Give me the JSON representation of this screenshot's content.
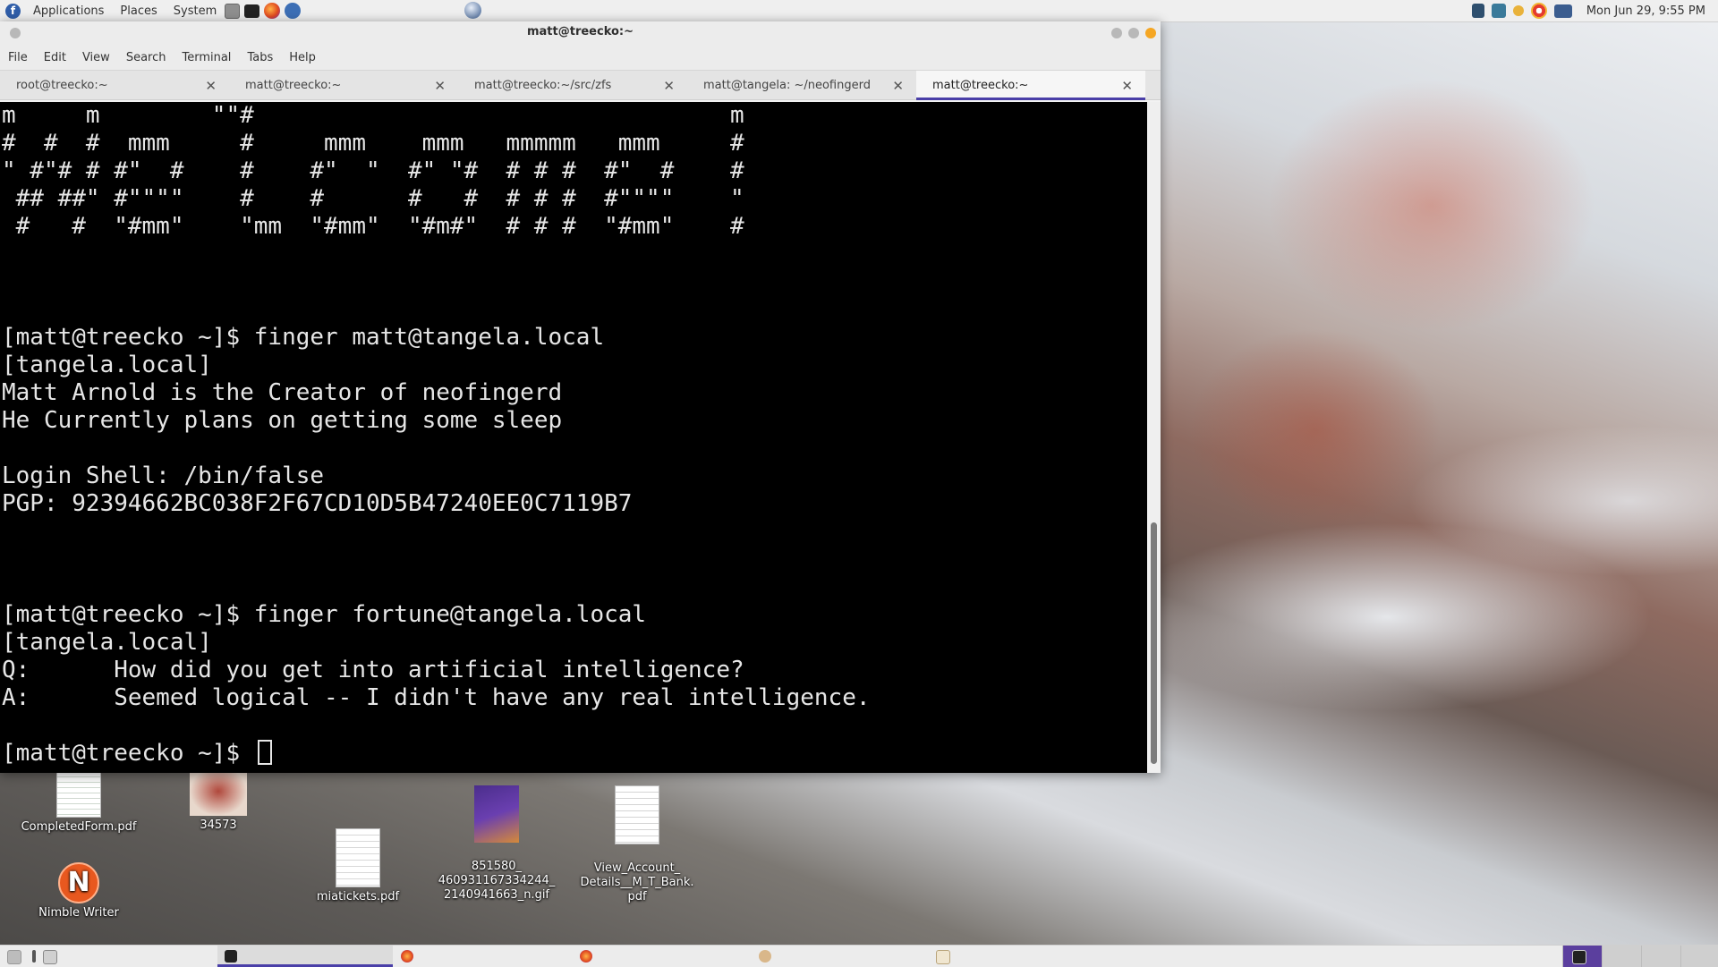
{
  "top_panel": {
    "menus": [
      "Applications",
      "Places",
      "System"
    ],
    "clock": "Mon Jun 29,  9:55 PM",
    "icons": [
      "fedora-logo-icon",
      "file-manager-icon",
      "terminal-icon",
      "firefox-icon",
      "github-desktop-icon",
      "network-globe-icon"
    ],
    "tray_icons": [
      "workspace-tray-icon",
      "mail-tray-icon",
      "updates-tray-icon",
      "help-tray-icon",
      "display-tray-icon"
    ]
  },
  "window": {
    "title": "matt@treecko:~",
    "menu": [
      "File",
      "Edit",
      "View",
      "Search",
      "Terminal",
      "Tabs",
      "Help"
    ],
    "tabs": [
      {
        "label": "root@treecko:~",
        "close": "✕"
      },
      {
        "label": "matt@treecko:~",
        "close": "✕"
      },
      {
        "label": "matt@treecko:~/src/zfs",
        "close": "✕"
      },
      {
        "label": "matt@tangela: ~/neofingerd",
        "close": "✕"
      },
      {
        "label": "matt@treecko:~",
        "close": "✕",
        "active": true
      }
    ],
    "accent_color": "#4a3fa8",
    "close_color": "#f5a623"
  },
  "terminal": {
    "lines": [
      "m     m        \"\"#                                  m",
      "#  #  #  mmm     #     mmm    mmm   mmmmm   mmm     #",
      "\" #\"# # #\"  #    #    #\"  \"  #\" \"#  # # #  #\"  #    #",
      " ## ##\" #\"\"\"\"    #    #      #   #  # # #  #\"\"\"\"    \"",
      " #   #  \"#mm\"    \"mm  \"#mm\"  \"#m#\"  # # #  \"#mm\"    #",
      "",
      "",
      "",
      "[matt@treecko ~]$ finger matt@tangela.local",
      "[tangela.local]",
      "Matt Arnold is the Creator of neofingerd",
      "He Currently plans on getting some sleep",
      "",
      "Login Shell: /bin/false",
      "PGP: 92394662BC038F2F67CD10D5B47240EE0C7119B7",
      "",
      "",
      "",
      "[matt@treecko ~]$ finger fortune@tangela.local",
      "[tangela.local]",
      "Q:      How did you get into artificial intelligence?",
      "A:      Seemed logical -- I didn't have any real intelligence.",
      ""
    ],
    "prompt": "[matt@treecko ~]$ "
  },
  "desktop_icons": [
    {
      "label": "CompletedForm.pdf",
      "icon": "pdf-thumbnail-icon"
    },
    {
      "label": "34573",
      "icon": "dragon-image-icon"
    },
    {
      "label": "851580_\n460931167334244_\n2140941663_n.gif",
      "icon": "gif-image-icon"
    },
    {
      "label": "View_Account_\nDetails__M_T_Bank.\npdf",
      "icon": "pdf-thumbnail-icon"
    },
    {
      "label": "miatickets.pdf",
      "icon": "pdf-thumbnail-icon"
    },
    {
      "label": "Nimble Writer",
      "icon": "nimble-writer-icon"
    }
  ],
  "bottom_panel": {
    "taskbar_icons": [
      "show-desktop-icon",
      "window-list-icon",
      "terminal-task-icon",
      "firefox-task-icon",
      "firefox-task-icon",
      "pidgin-task-icon",
      "file-manager-task-icon"
    ],
    "workspaces": 4
  }
}
